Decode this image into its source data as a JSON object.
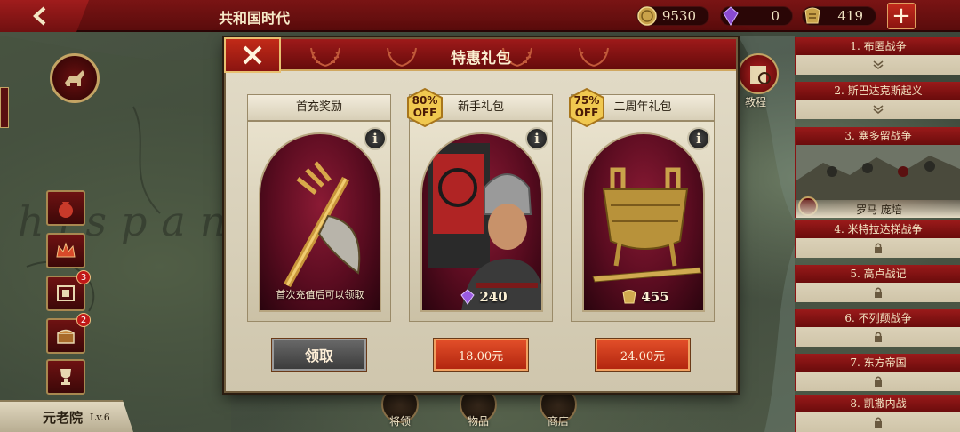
{
  "top_bar": {
    "era_title": "共和国时代",
    "resources": [
      {
        "name": "gold",
        "icon": "coin-icon",
        "value": "9530"
      },
      {
        "name": "gem",
        "icon": "purple-gem-icon",
        "value": "0"
      },
      {
        "name": "laurel-token",
        "icon": "laurel-token-icon",
        "value": "419"
      }
    ],
    "add_label": "+"
  },
  "map": {
    "region_label": "hispan"
  },
  "left_sidebar": {
    "buttons": [
      {
        "name": "bag",
        "icon": "money-bag-icon",
        "badge": ""
      },
      {
        "name": "crown",
        "icon": "crown-icon",
        "badge": ""
      },
      {
        "name": "film",
        "icon": "film-icon",
        "badge": "3"
      },
      {
        "name": "chest",
        "icon": "chest-icon",
        "badge": "2"
      },
      {
        "name": "trophy",
        "icon": "trophy-icon",
        "badge": ""
      }
    ],
    "senate": {
      "name": "元老院",
      "level": "Lv.6"
    }
  },
  "tutorial_label": "教程",
  "wars": [
    {
      "label": "1. 布匿战争",
      "state": "expand"
    },
    {
      "label": "2. 斯巴达克斯起义",
      "state": "expand"
    },
    {
      "label": "3. 塞多留战争",
      "state": "active",
      "footer": "罗马 庞培"
    },
    {
      "label": "4. 米特拉达梯战争",
      "state": "locked"
    },
    {
      "label": "5. 高卢战记",
      "state": "locked"
    },
    {
      "label": "6. 不列颠战争",
      "state": "locked"
    },
    {
      "label": "7. 东方帝国",
      "state": "locked"
    },
    {
      "label": "8. 凯撒内战",
      "state": "locked"
    }
  ],
  "bottom_nav": [
    {
      "label": "将领"
    },
    {
      "label": "物品"
    },
    {
      "label": "商店"
    }
  ],
  "popup": {
    "title": "特惠礼包",
    "cards": [
      {
        "title": "首充奖励",
        "condition": "首次充值后可以领取",
        "button": "领取",
        "button_style": "grey",
        "discount": "",
        "amount": "",
        "amount_icon": ""
      },
      {
        "title": "新手礼包",
        "condition": "",
        "button": "18.00元",
        "button_style": "red",
        "discount": "80%",
        "discount_word": "OFF",
        "amount": "240",
        "amount_icon": "purple-gem-icon"
      },
      {
        "title": "二周年礼包",
        "condition": "",
        "button": "24.00元",
        "button_style": "red",
        "discount": "75%",
        "discount_word": "OFF",
        "amount": "455",
        "amount_icon": "laurel-token-icon"
      }
    ],
    "info_label": "i",
    "colors": {
      "header_red": "#9e1a1a",
      "button_red": "#e4502a",
      "gold": "#f0c850"
    }
  }
}
